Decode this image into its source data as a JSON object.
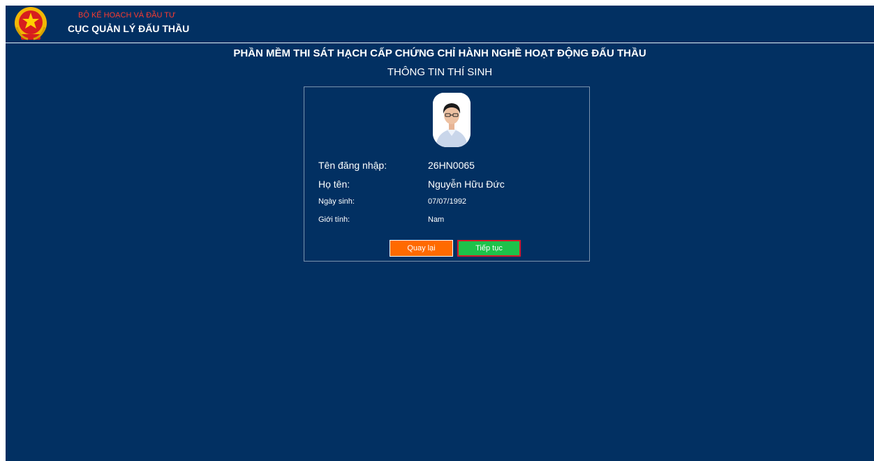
{
  "header": {
    "ministry": "BỘ KẾ HOẠCH VÀ ĐẦU TƯ",
    "agency": "CỤC QUẢN LÝ ĐẤU THẦU",
    "emblem_icon": "vietnam-national-emblem-icon"
  },
  "page": {
    "title": "PHẦN MỀM THI SÁT HẠCH CẤP CHỨNG CHỈ HÀNH NGHỀ HOẠT ĐỘNG ĐẤU THẦU",
    "subtitle": "THÔNG TIN THÍ SINH"
  },
  "candidate": {
    "photo_icon": "candidate-photo",
    "fields": [
      {
        "label": "Tên đăng nhập:",
        "value": "26HN0065"
      },
      {
        "label": "Họ tên:",
        "value": "Nguyễn Hữu Đức"
      },
      {
        "label": "Ngày sinh:",
        "value": "07/07/1992"
      },
      {
        "label": "Giới tính:",
        "value": "Nam"
      }
    ]
  },
  "buttons": {
    "back": "Quay lại",
    "next": "Tiếp tục"
  },
  "colors": {
    "background": "#023062",
    "ministry_text": "#ff3b2f",
    "back_button": "#ff6a00",
    "next_button": "#1ec24a",
    "next_button_border": "#d81a2b"
  }
}
